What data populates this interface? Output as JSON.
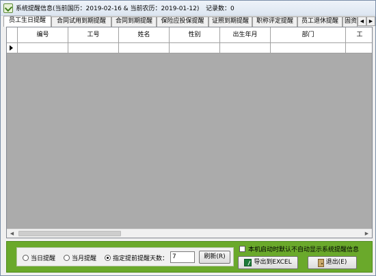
{
  "window": {
    "title": "系统提醒信息(当前国历：2019-02-16 & 当前农历：2019-01-12)",
    "record_count": "记录数：0"
  },
  "tabs": [
    {
      "label": "员工生日提醒",
      "active": true
    },
    {
      "label": "合同试用到期提醒",
      "active": false
    },
    {
      "label": "合同到期提醒",
      "active": false
    },
    {
      "label": "保险应投保提醒",
      "active": false
    },
    {
      "label": "证照到期提醒",
      "active": false
    },
    {
      "label": "职称评定提醒",
      "active": false
    },
    {
      "label": "员工退休提醒",
      "active": false
    },
    {
      "label": "固资",
      "active": false
    }
  ],
  "tab_scroll": {
    "left_icon": "arrow-left-icon",
    "right_icon": "arrow-right-icon",
    "left_glyph": "◀",
    "right_glyph": "▶"
  },
  "grid": {
    "columns": [
      "",
      "编号",
      "工号",
      "姓名",
      "性别",
      "出生年月",
      "部门",
      "工"
    ],
    "rows": [
      []
    ]
  },
  "scrollbar": {
    "left_glyph": "◀",
    "right_glyph": "▶"
  },
  "options": {
    "radio_today": "当日提醒",
    "radio_month": "当月提醒",
    "radio_days": "指定提前提醒天数：",
    "selected": "radio_days",
    "days_value": "7",
    "refresh_label": "刷新(R)"
  },
  "startup_checkbox": {
    "label": "本机启动时默认不自动显示系统提醒信息",
    "checked": false
  },
  "buttons": {
    "export_label": "导出到EXCEL",
    "exit_label": "退出(E)"
  },
  "colors": {
    "bottom_panel": "#6aa92b",
    "grid_background": "#ababab"
  }
}
